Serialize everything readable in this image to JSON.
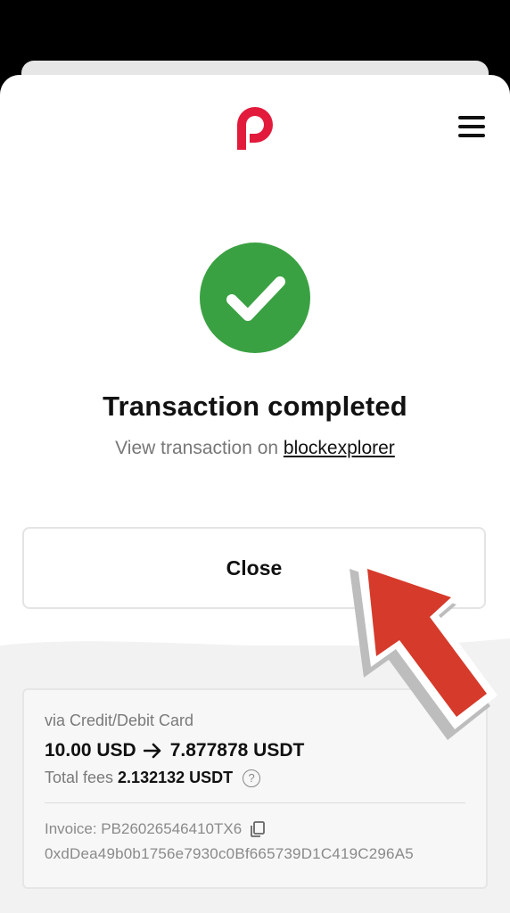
{
  "header": {
    "logo_icon": "p-logo-icon",
    "menu_icon": "hamburger-menu-icon",
    "brand_color": "#e21b3c"
  },
  "status": {
    "icon": "checkmark-circle-icon",
    "color": "#3aa142",
    "title": "Transaction completed",
    "subtitle_prefix": "View transaction on ",
    "subtitle_link": "blockexplorer"
  },
  "actions": {
    "close_label": "Close"
  },
  "details": {
    "method": "via Credit/Debit Card",
    "amount_from": "10.00 USD",
    "amount_to": "7.877878 USDT",
    "fees_label": "Total fees",
    "fees_value": "2.132132 USDT",
    "fees_help": "?",
    "invoice": "Invoice: PB26026546410TX6",
    "address": "0xdDea49b0b1756e7930c0Bf665739D1C419C296A5"
  },
  "overlay": {
    "arrow_icon": "red-pointer-arrow-icon",
    "arrow_color": "#d63a2b"
  }
}
